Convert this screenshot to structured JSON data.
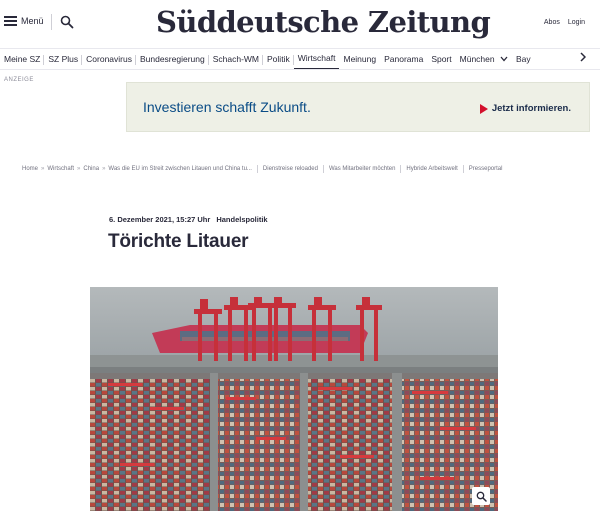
{
  "header": {
    "menu_label": "Menü",
    "logo_text": "Süddeutsche Zeitung",
    "abos_label": "Abos",
    "login_label": "Login"
  },
  "nav": {
    "items": [
      "Meine SZ",
      "SZ Plus",
      "Coronavirus",
      "Bundesregierung",
      "Schach-WM",
      "Politik",
      "Wirtschaft",
      "Meinung",
      "Panorama",
      "Sport",
      "München",
      "Bay"
    ],
    "active": "Wirtschaft",
    "dropdown_item": "München"
  },
  "ad": {
    "label": "ANZEIGE",
    "headline": "Investieren schafft Zukunft.",
    "cta": "Jetzt informieren."
  },
  "breadcrumb": {
    "path": [
      "Home",
      "Wirtschaft",
      "China",
      "Was die EU im Streit zwischen Litauen und China tu..."
    ],
    "related": [
      "Dienstreise reloaded",
      "Was Mitarbeiter möchten",
      "Hybride Arbeitswelt",
      "Presseportal"
    ]
  },
  "article": {
    "date": "6. Dezember 2021, 15:27 Uhr",
    "topic": "Handelspolitik",
    "headline": "Törichte Litauer"
  },
  "colors": {
    "text": "#29293a",
    "ad_background": "#eef0e6",
    "ad_headline": "#0a4c86",
    "ad_arrow": "#d3102c"
  }
}
